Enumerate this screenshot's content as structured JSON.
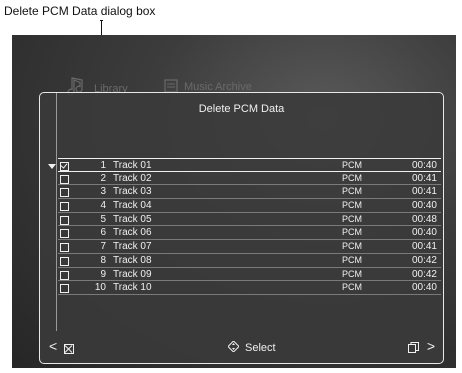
{
  "annotation": {
    "callout_text": "Delete PCM Data dialog box"
  },
  "tabs": {
    "library": "Library",
    "music_archive": "Music Archive"
  },
  "dialog": {
    "title": "Delete PCM Data",
    "selected_index": 0,
    "tracks": [
      {
        "checked": true,
        "num": "1",
        "title": "Track 01",
        "format": "PCM",
        "time": "00:40"
      },
      {
        "checked": false,
        "num": "2",
        "title": "Track 02",
        "format": "PCM",
        "time": "00:41"
      },
      {
        "checked": false,
        "num": "3",
        "title": "Track 03",
        "format": "PCM",
        "time": "00:41"
      },
      {
        "checked": false,
        "num": "4",
        "title": "Track 04",
        "format": "PCM",
        "time": "00:40"
      },
      {
        "checked": false,
        "num": "5",
        "title": "Track 05",
        "format": "PCM",
        "time": "00:48"
      },
      {
        "checked": false,
        "num": "6",
        "title": "Track 06",
        "format": "PCM",
        "time": "00:40"
      },
      {
        "checked": false,
        "num": "7",
        "title": "Track 07",
        "format": "PCM",
        "time": "00:41"
      },
      {
        "checked": false,
        "num": "8",
        "title": "Track 08",
        "format": "PCM",
        "time": "00:42"
      },
      {
        "checked": false,
        "num": "9",
        "title": "Track 09",
        "format": "PCM",
        "time": "00:42"
      },
      {
        "checked": false,
        "num": "10",
        "title": "Track 10",
        "format": "PCM",
        "time": "00:40"
      }
    ],
    "footer": {
      "left_chevron": "<",
      "select_label": "Select",
      "right_chevron": ">"
    }
  },
  "icons": {
    "library": "music-note-icon",
    "music_archive": "archive-icon",
    "cancel": "cancel-box-icon",
    "select": "dpad-icon",
    "page": "page-icon"
  },
  "colors": {
    "screen_background": "#2e2e2e",
    "dialog_border": "#e8e8e8",
    "text": "#f0f0f0",
    "inactive_tab_text": "#6a6a6a"
  }
}
